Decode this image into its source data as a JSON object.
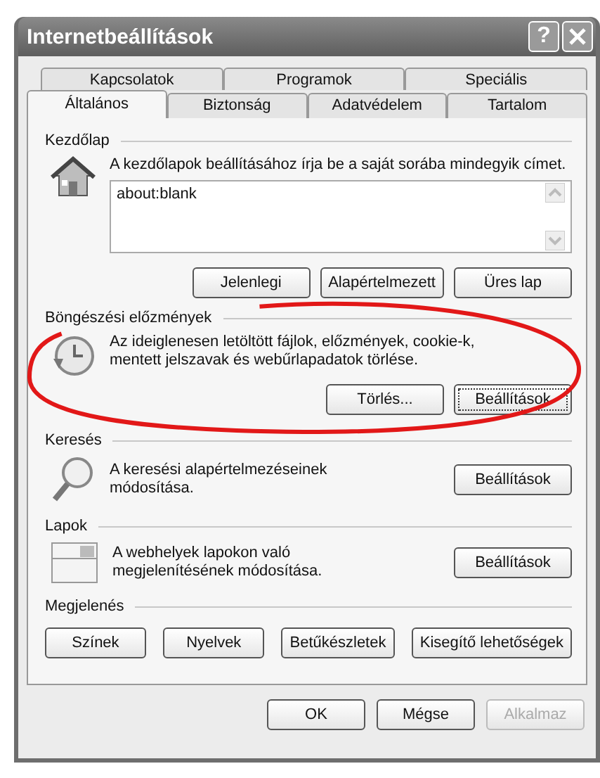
{
  "window": {
    "title": "Internetbeállítások",
    "help": "?"
  },
  "tabs": {
    "back_row": [
      {
        "label": "Kapcsolatok",
        "selected": false
      },
      {
        "label": "Programok",
        "selected": false
      },
      {
        "label": "Speciális",
        "selected": false
      }
    ],
    "front_row": [
      {
        "label": "Általános",
        "selected": true
      },
      {
        "label": "Biztonság",
        "selected": false
      },
      {
        "label": "Adatvédelem",
        "selected": false
      },
      {
        "label": "Tartalom",
        "selected": false
      }
    ]
  },
  "homepage": {
    "heading": "Kezdőlap",
    "description": "A kezdőlapok beállításához írja be a saját sorába mindegyik címet.",
    "value": "about:blank",
    "buttons": [
      {
        "label": "Jelenlegi",
        "focused": false
      },
      {
        "label": "Alapértelmezett",
        "focused": false
      },
      {
        "label": "Üres lap",
        "focused": false
      }
    ]
  },
  "sections": [
    {
      "kind": "history",
      "heading": "Böngészési előzmények",
      "description": "Az ideiglenesen letöltött fájlok, előzmények, cookie-k, mentett jelszavak és webűrlapadatok törlése.",
      "buttons": [
        {
          "label": "Törlés...",
          "focused": false
        },
        {
          "label": "Beállítások",
          "focused": true
        }
      ]
    },
    {
      "kind": "search",
      "heading": "Keresés",
      "description": "A keresési alapértelmezéseinek módosítása.",
      "buttons": [
        {
          "label": "Beállítások",
          "focused": false
        }
      ]
    },
    {
      "kind": "tabs",
      "heading": "Lapok",
      "description": "A webhelyek lapokon való megjelenítésének módosítása.",
      "buttons": [
        {
          "label": "Beállítások",
          "focused": false
        }
      ]
    }
  ],
  "appearance": {
    "heading": "Megjelenés",
    "buttons": [
      {
        "label": "Színek",
        "focused": false
      },
      {
        "label": "Nyelvek",
        "focused": false
      },
      {
        "label": "Betűkészletek",
        "focused": false
      },
      {
        "label": "Kisegítő lehetőségek",
        "focused": false
      }
    ]
  },
  "dialog_buttons": [
    {
      "label": "OK",
      "disabled": false
    },
    {
      "label": "Mégse",
      "disabled": false
    },
    {
      "label": "Alkalmaz",
      "disabled": true
    }
  ]
}
